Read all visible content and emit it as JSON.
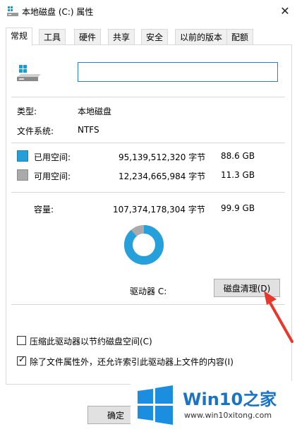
{
  "window": {
    "title": "本地磁盘 (C:) 属性",
    "close_symbol": "✕"
  },
  "tabs": [
    {
      "label": "常规",
      "active": true
    },
    {
      "label": "工具"
    },
    {
      "label": "硬件"
    },
    {
      "label": "共享"
    },
    {
      "label": "安全"
    },
    {
      "label": "以前的版本"
    },
    {
      "label": "配额"
    }
  ],
  "general": {
    "name_value": "",
    "type_label": "类型:",
    "type_value": "本地磁盘",
    "fs_label": "文件系统:",
    "fs_value": "NTFS",
    "used_label": "已用空间:",
    "used_bytes": "95,139,512,320 字节",
    "used_size": "88.6 GB",
    "free_label": "可用空间:",
    "free_bytes": "12,234,665,984 字节",
    "free_size": "11.3 GB",
    "capacity_label": "容量:",
    "capacity_bytes": "107,374,178,304 字节",
    "capacity_size": "99.9 GB",
    "drive_label": "驱动器 C:",
    "cleanup_button": "磁盘清理(D)",
    "compress_label": "压缩此驱动器以节约磁盘空间(C)",
    "compress_checked": false,
    "index_label": "除了文件属性外，还允许索引此驱动器上文件的内容(I)",
    "index_checked": true,
    "used_fraction": 0.886
  },
  "buttons": {
    "ok": "确定"
  },
  "colors": {
    "used": "#26a0da",
    "free": "#aaaaaa",
    "annotation_arrow": "#e8382b"
  },
  "watermark": {
    "title_latin": "Win10",
    "title_cn": "之家",
    "url": "www.win10xitong.com"
  }
}
